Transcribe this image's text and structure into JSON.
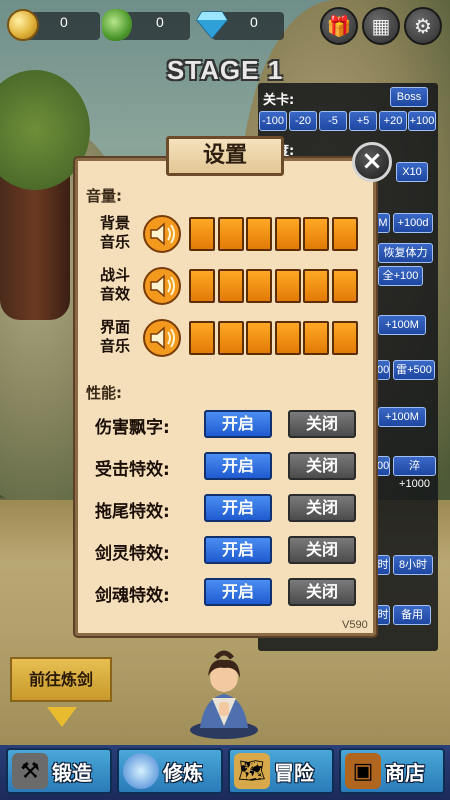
{
  "resources": {
    "gold": "0",
    "jade": "0",
    "diamond": "0"
  },
  "stage_title": "STAGE 1",
  "debug": {
    "level_label": "关卡:",
    "boss": "Boss",
    "level_buttons": [
      "-100",
      "-20",
      "-5",
      "+5",
      "+20",
      "+100"
    ],
    "speed_label": "速度:",
    "x10": "X10",
    "row_a": [
      "M",
      "+100d"
    ],
    "row_b": "恢复体力",
    "row_c": "全+100",
    "row_d": "+100M",
    "row_e": [
      "00",
      "雷+500"
    ],
    "row_f": "+100M",
    "row_g": [
      "00",
      "淬+1000"
    ],
    "row_h": [
      "时",
      "8小时"
    ],
    "row_i": [
      "时",
      "备用"
    ]
  },
  "dialog": {
    "title": "设置",
    "close": "×",
    "volume_section": "音量:",
    "volume_rows": [
      {
        "line1": "背景",
        "line2": "音乐",
        "level": 1.0
      },
      {
        "line1": "战斗",
        "line2": "音效",
        "level": 1.0
      },
      {
        "line1": "界面",
        "line2": "音乐",
        "level": 1.0
      }
    ],
    "perf_section": "性能:",
    "perf_rows": [
      {
        "label": "伤害飘字:",
        "on": "开启",
        "off": "关闭"
      },
      {
        "label": "受击特效:",
        "on": "开启",
        "off": "关闭"
      },
      {
        "label": "拖尾特效:",
        "on": "开启",
        "off": "关闭"
      },
      {
        "label": "剑灵特效:",
        "on": "开启",
        "off": "关闭"
      },
      {
        "label": "剑魂特效:",
        "on": "开启",
        "off": "关闭"
      }
    ],
    "version": "V590"
  },
  "forge_prompt": "前往炼剑",
  "nav": [
    {
      "label": "锻造",
      "icon": "anvil-icon"
    },
    {
      "label": "修炼",
      "icon": "orb-icon"
    },
    {
      "label": "冒险",
      "icon": "map-icon"
    },
    {
      "label": "商店",
      "icon": "chest-icon"
    }
  ],
  "colors": {
    "on_button": "#2f6fe0",
    "off_button": "#5e5e5e",
    "volume_bar": "#f08a0c",
    "dialog_bg": "#f4dfba"
  }
}
